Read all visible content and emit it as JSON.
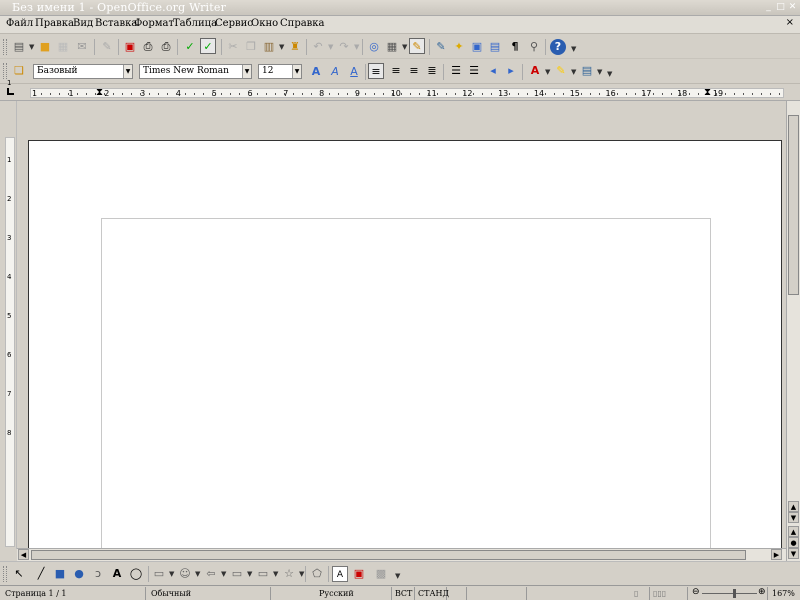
{
  "window": {
    "title": "Без имени 1 - OpenOffice.org Writer",
    "controls": [
      "_",
      "□",
      "✕"
    ]
  },
  "menu": {
    "items": [
      "Файл",
      "Правка",
      "Вид",
      "Вставка",
      "Формат",
      "Таблица",
      "Сервис",
      "Окно",
      "Справка"
    ],
    "close_label": "×"
  },
  "toolbar_standard": {
    "icons": [
      "new-document-icon",
      "open-folder-icon",
      "save-icon",
      "email-icon",
      "edit-file-icon",
      "export-pdf-icon",
      "print-icon",
      "print-preview-icon",
      "spellcheck-icon",
      "autospellcheck-icon",
      "cut-icon",
      "copy-icon",
      "paste-icon",
      "format-paintbrush-icon",
      "undo-icon",
      "redo-icon",
      "hyperlink-icon",
      "table-icon",
      "show-draw-functions-icon",
      "chart-icon",
      "navigator-icon",
      "gallery-icon",
      "datasource-icon",
      "nonprinting-chars-icon",
      "zoom-icon",
      "help-icon"
    ]
  },
  "toolbar_formatting": {
    "paragraph_style": "Базовый",
    "font_name": "Times New Roman",
    "font_size": "12",
    "icons": [
      "styles-icon",
      "bold-icon",
      "italic-icon",
      "underline-icon",
      "align-left-icon",
      "align-center-icon",
      "align-right-icon",
      "justify-icon",
      "numbering-icon",
      "bullets-icon",
      "decrease-indent-icon",
      "increase-indent-icon",
      "font-color-icon",
      "highlight-icon",
      "background-color-icon"
    ]
  },
  "ruler": {
    "labels": [
      "1",
      "1",
      "2",
      "3",
      "4",
      "5",
      "6",
      "7",
      "8",
      "9",
      "10",
      "11",
      "12",
      "13",
      "14",
      "15",
      "16",
      "17",
      "18",
      "19"
    ]
  },
  "vruler": {
    "labels": [
      "1",
      "1",
      "2",
      "3",
      "4",
      "5",
      "6",
      "7",
      "8"
    ]
  },
  "drawbar": {
    "icons": [
      "select-arrow-icon",
      "line-icon",
      "rectangle-icon",
      "ellipse-icon",
      "freeform-icon",
      "text-icon",
      "callout-icon",
      "basic-shapes-icon",
      "symbol-shapes-icon",
      "block-arrows-icon",
      "flowchart-icon",
      "callouts-icon",
      "stars-icon",
      "points-icon",
      "fontwork-icon",
      "from-file-icon",
      "extrusion-icon"
    ]
  },
  "status": {
    "page": "Страница  1 / 1",
    "style": "Обычный",
    "language": "Русский",
    "insert_mode": "ВСТ",
    "selection_mode": "СТАНД",
    "zoom": "167%"
  }
}
